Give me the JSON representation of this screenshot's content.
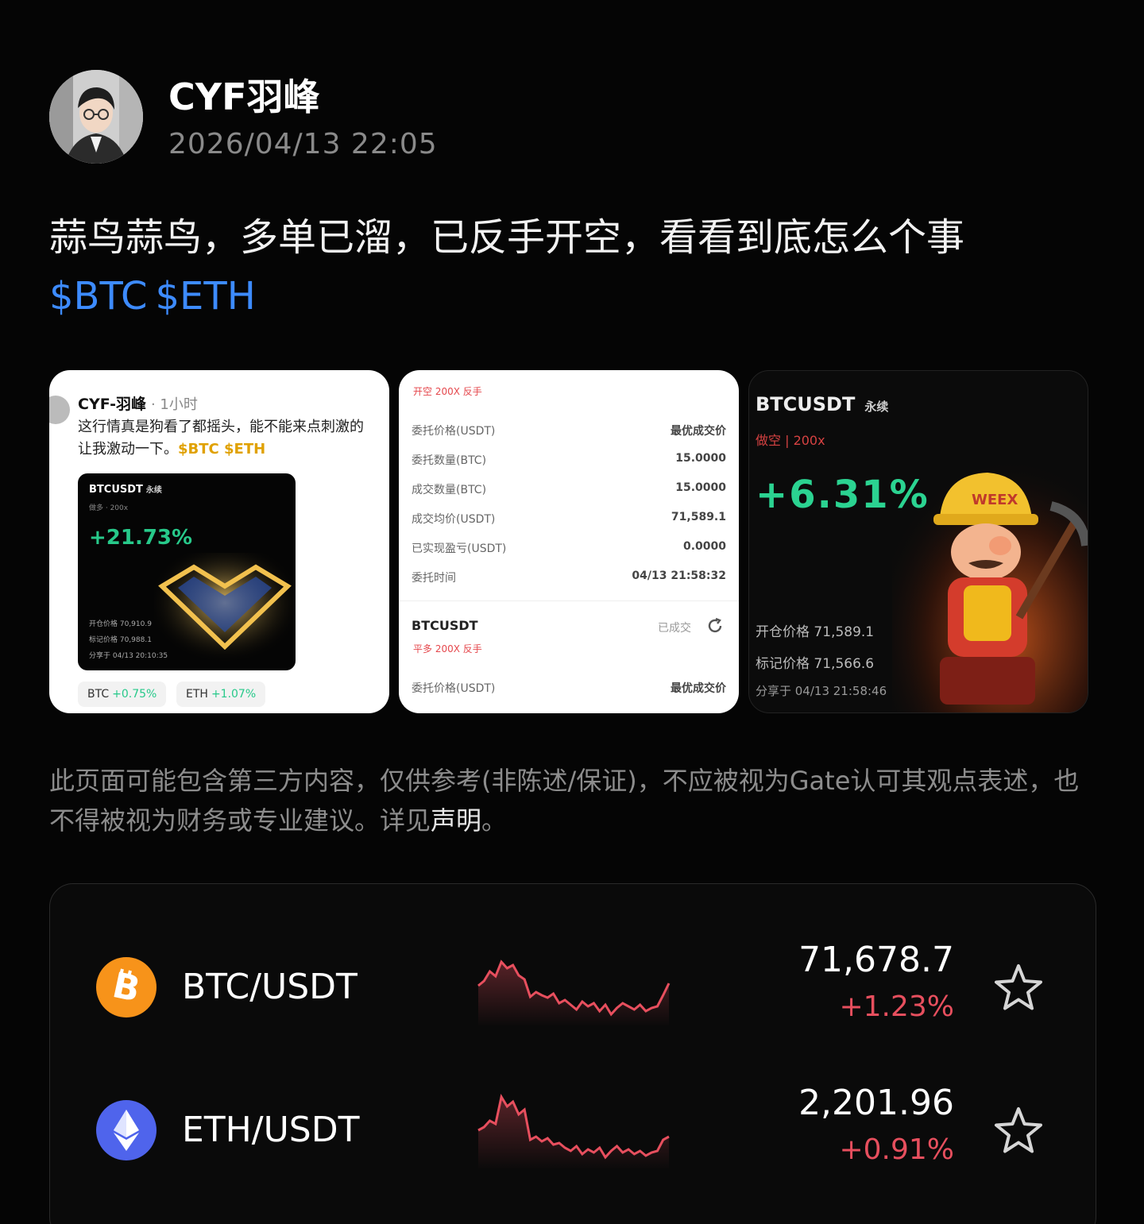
{
  "post": {
    "author": "CYF羽峰",
    "time": "2026/04/13 22:05",
    "text": "蒜鸟蒜鸟，多单已溜，已反手开空，看看到底怎么个事",
    "tags": [
      "$BTC",
      "$ETH"
    ]
  },
  "images": {
    "card1": {
      "author": "CYF-羽峰",
      "age": "· 1小时",
      "line1": "这行情真是狗看了都摇头，能不能来点刺激的",
      "line2": "让我激动一下。",
      "tags": "$BTC $ETH",
      "inner": {
        "title": "BTCUSDT",
        "title_small": "永续",
        "sub": "做多 · 200x",
        "pct": "+21.73%",
        "open": "开仓价格 70,910.9",
        "mark": "标记价格 70,988.1",
        "shared": "分享于 04/13 20:10:35"
      },
      "chips": [
        {
          "name": "BTC",
          "change": "+0.75%"
        },
        {
          "name": "ETH",
          "change": "+1.07%"
        }
      ]
    },
    "card2": {
      "top_labels": "开空   200X   反手",
      "rows": [
        {
          "label": "委托价格(USDT)",
          "value": "最优成交价"
        },
        {
          "label": "委托数量(BTC)",
          "value": "15.0000"
        },
        {
          "label": "成交数量(BTC)",
          "value": "15.0000"
        },
        {
          "label": "成交均价(USDT)",
          "value": "71,589.1"
        },
        {
          "label": "已实现盈亏(USDT)",
          "value": "0.0000"
        },
        {
          "label": "委托时间",
          "value": "04/13 21:58:32"
        }
      ],
      "order2_title": "BTCUSDT",
      "order2_status": "已成交",
      "order2_labels": "平多   200X   反手",
      "order2_row": {
        "label": "委托价格(USDT)",
        "value": "最优成交价"
      }
    },
    "card3": {
      "title": "BTCUSDT",
      "title_small": "永续",
      "sub": "做空 | 200x",
      "pct": "+6.31%",
      "open": "开仓价格 71,589.1",
      "mark": "标记价格 71,566.6",
      "shared": "分享于 04/13 21:58:46",
      "badge": "WEEX"
    }
  },
  "disclaimer": {
    "text": "此页面可能包含第三方内容，仅供参考(非陈述/保证)，不应被视为Gate认可其观点表述，也不得被视为财务或专业建议。详见",
    "link": "声明",
    "end": "。"
  },
  "market": [
    {
      "pair": "BTC/USDT",
      "price": "71,678.7",
      "change": "+1.23%",
      "icon": "bitcoin-icon",
      "color": "#f7931a",
      "spark": [
        48,
        42,
        30,
        36,
        18,
        26,
        22,
        35,
        40,
        62,
        56,
        60,
        63,
        58,
        70,
        66,
        72,
        78,
        68,
        74,
        70,
        80,
        72,
        84,
        76,
        70,
        74,
        78,
        72,
        80,
        76,
        74,
        60,
        45
      ]
    },
    {
      "pair": "ETH/USDT",
      "price": "2,201.96",
      "change": "+0.91%",
      "icon": "ethereum-icon",
      "color": "#4f64ec",
      "spark": [
        50,
        46,
        38,
        42,
        8,
        20,
        14,
        30,
        24,
        62,
        58,
        64,
        60,
        68,
        66,
        72,
        76,
        70,
        80,
        74,
        78,
        72,
        84,
        76,
        70,
        78,
        74,
        80,
        76,
        82,
        78,
        76,
        62,
        58
      ]
    }
  ],
  "colors": {
    "accent": "#3d8bff",
    "down": "#e74f5e",
    "up": "#27c98a"
  }
}
